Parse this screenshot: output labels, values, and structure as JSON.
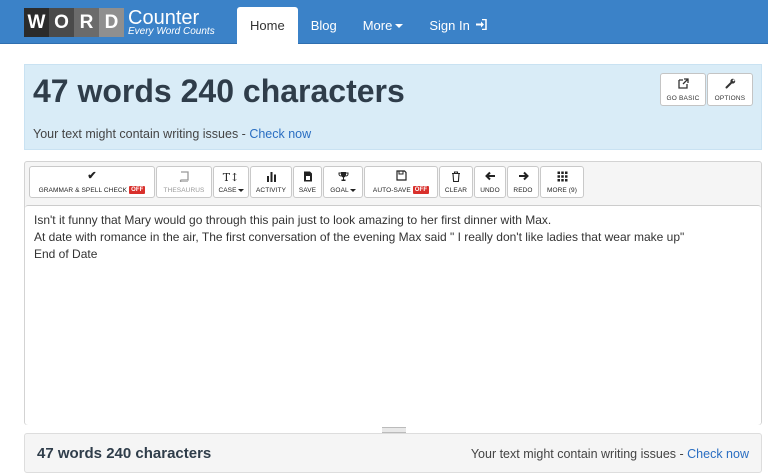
{
  "logo": {
    "letters": [
      "W",
      "O",
      "R",
      "D"
    ],
    "title": "Counter",
    "subtitle": "Every Word Counts"
  },
  "nav": {
    "home": "Home",
    "blog": "Blog",
    "more": "More",
    "signin": "Sign In"
  },
  "summary": {
    "title": "47 words 240 characters",
    "issues_text": "Your text might contain writing issues - ",
    "check_now": "Check now"
  },
  "top_buttons": {
    "go_basic": "GO BASIC",
    "options": "OPTIONS"
  },
  "toolbar": {
    "grammar": "GRAMMAR & SPELL CHECK",
    "grammar_badge": "OFF",
    "thesaurus": "THESAURUS",
    "case": "CASE",
    "case_icon": "T↕",
    "activity": "ACTIVITY",
    "save": "SAVE",
    "goal": "GOAL",
    "autosave": "AUTO-SAVE",
    "autosave_badge": "OFF",
    "clear": "CLEAR",
    "undo": "UNDO",
    "redo": "REDO",
    "more": "MORE (9)"
  },
  "editor": {
    "lines": [
      "Isn't it funny that Mary would go through this pain just to look amazing to her first dinner with Max.",
      "At date with romance in the air, The first conversation of the evening Max said \" I really don't like ladies that wear make up\"",
      "End of Date"
    ]
  },
  "footer": {
    "count": "47 words 240 characters",
    "issues_text": "Your text might contain writing issues - ",
    "check_now": "Check now"
  },
  "colors": {
    "navbar": "#3b82c8",
    "panel": "#d9ecf7",
    "link": "#2a6ec2",
    "badge": "#d9302c"
  }
}
